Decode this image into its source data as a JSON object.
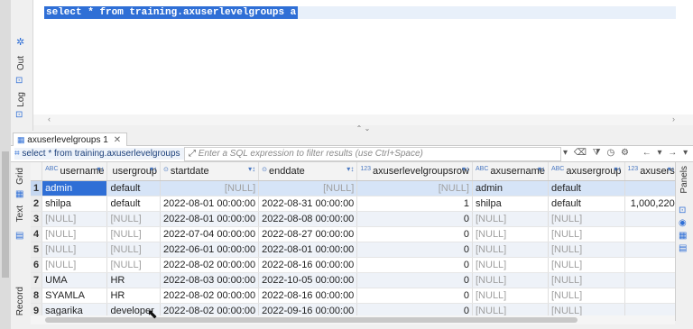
{
  "editor": {
    "sql": "select * from training.axuserlevelgroups a"
  },
  "left_tabs": {
    "out": "Out",
    "log": "Log"
  },
  "result_tab": {
    "label": "axuserlevelgroups 1",
    "close": "✕"
  },
  "filter": {
    "query_label": "select * from training.axuserlevelgroups",
    "placeholder": "Enter a SQL expression to filter results (use Ctrl+Space)"
  },
  "side_tabs": {
    "grid": "Grid",
    "text": "Text",
    "record": "Record",
    "panels": "Panels"
  },
  "columns": [
    {
      "type": "ABC",
      "name": "username"
    },
    {
      "type": "",
      "name": "usergroup"
    },
    {
      "type": "⊙",
      "name": "startdate"
    },
    {
      "type": "⊙",
      "name": "enddate"
    },
    {
      "type": "123",
      "name": "axuserlevelgroupsrow"
    },
    {
      "type": "ABC",
      "name": "axusername"
    },
    {
      "type": "ABC",
      "name": "axusergroup"
    },
    {
      "type": "123",
      "name": "axusers"
    }
  ],
  "rows": [
    {
      "n": "1",
      "username": "admin",
      "usergroup": "default",
      "startdate": "[NULL]",
      "enddate": "[NULL]",
      "row": "[NULL]",
      "axusername": "admin",
      "axusergroup": "default",
      "axusers": ""
    },
    {
      "n": "2",
      "username": "shilpa",
      "usergroup": "default",
      "startdate": "2022-08-01 00:00:00",
      "enddate": "2022-08-31 00:00:00",
      "row": "1",
      "axusername": "shilpa",
      "axusergroup": "default",
      "axusers": "1,000,220"
    },
    {
      "n": "3",
      "username": "[NULL]",
      "usergroup": "[NULL]",
      "startdate": "2022-08-01 00:00:00",
      "enddate": "2022-08-08 00:00:00",
      "row": "0",
      "axusername": "[NULL]",
      "axusergroup": "[NULL]",
      "axusers": ""
    },
    {
      "n": "4",
      "username": "[NULL]",
      "usergroup": "[NULL]",
      "startdate": "2022-07-04 00:00:00",
      "enddate": "2022-08-27 00:00:00",
      "row": "0",
      "axusername": "[NULL]",
      "axusergroup": "[NULL]",
      "axusers": ""
    },
    {
      "n": "5",
      "username": "[NULL]",
      "usergroup": "[NULL]",
      "startdate": "2022-06-01 00:00:00",
      "enddate": "2022-08-01 00:00:00",
      "row": "0",
      "axusername": "[NULL]",
      "axusergroup": "[NULL]",
      "axusers": ""
    },
    {
      "n": "6",
      "username": "[NULL]",
      "usergroup": "[NULL]",
      "startdate": "2022-08-02 00:00:00",
      "enddate": "2022-08-16 00:00:00",
      "row": "0",
      "axusername": "[NULL]",
      "axusergroup": "[NULL]",
      "axusers": ""
    },
    {
      "n": "7",
      "username": "UMA",
      "usergroup": "HR",
      "startdate": "2022-08-03 00:00:00",
      "enddate": "2022-10-05 00:00:00",
      "row": "0",
      "axusername": "[NULL]",
      "axusergroup": "[NULL]",
      "axusers": ""
    },
    {
      "n": "8",
      "username": "SYAMLA",
      "usergroup": "HR",
      "startdate": "2022-08-02 00:00:00",
      "enddate": "2022-08-16 00:00:00",
      "row": "0",
      "axusername": "[NULL]",
      "axusergroup": "[NULL]",
      "axusers": ""
    },
    {
      "n": "9",
      "username": "sagarika",
      "usergroup": "developer",
      "startdate": "2022-08-02 00:00:00",
      "enddate": "2022-09-16 00:00:00",
      "row": "0",
      "axusername": "[NULL]",
      "axusergroup": "[NULL]",
      "axusers": ""
    }
  ],
  "colors": {
    "selection": "#2f6fd6",
    "row_alt": "#eef2f8",
    "null_text": "#a0a0a0"
  }
}
